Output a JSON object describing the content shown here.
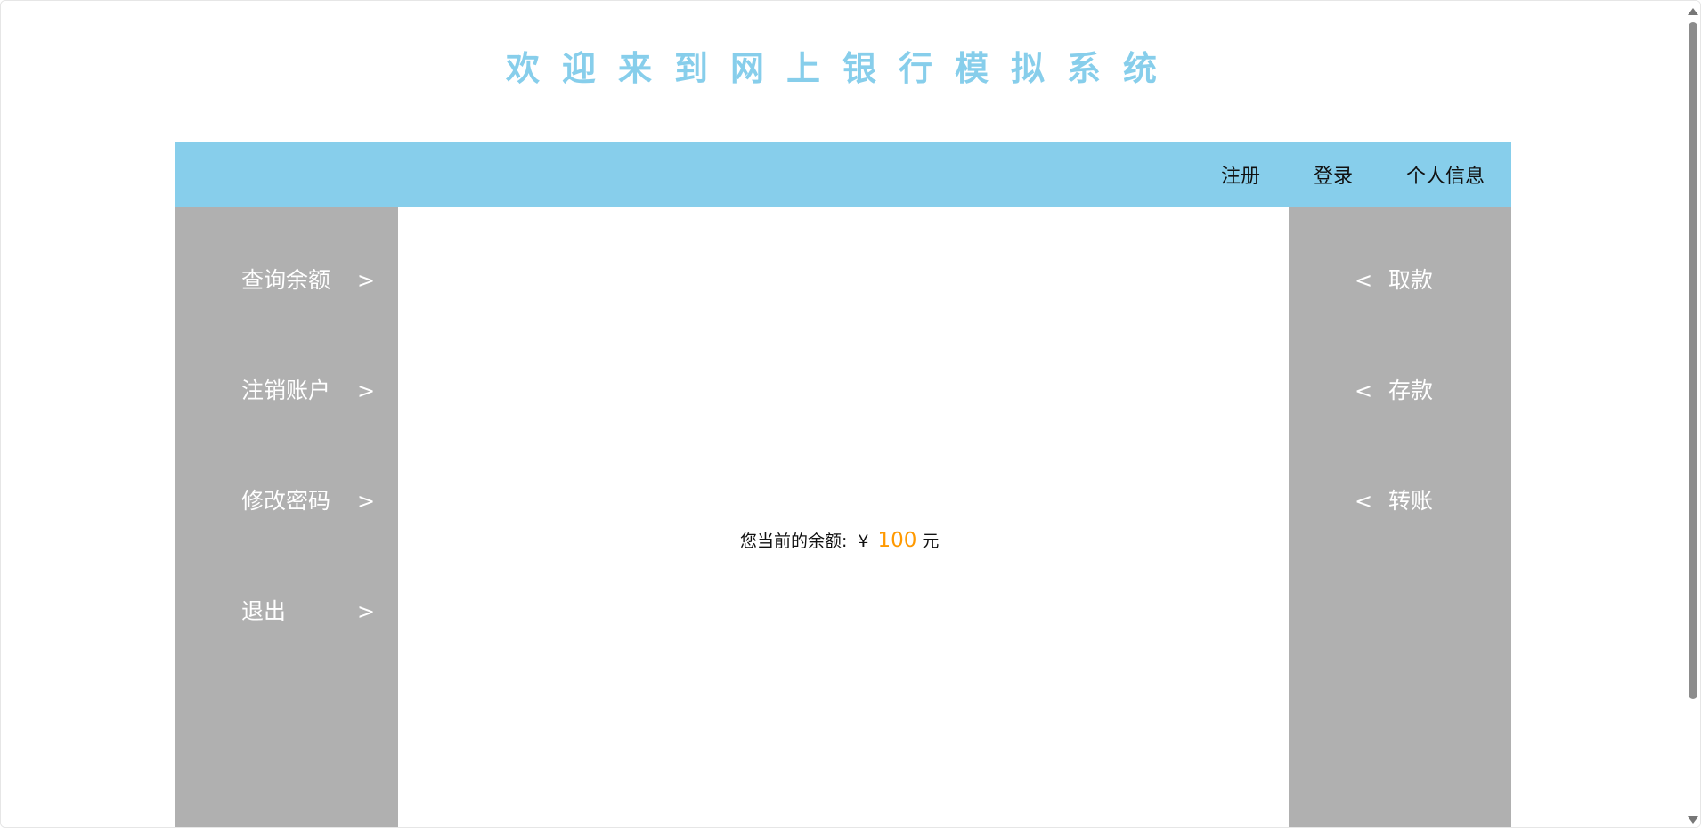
{
  "site": {
    "title": "欢迎来到网上银行模拟系统"
  },
  "topnav": {
    "items": [
      "注册",
      "登录",
      "个人信息"
    ]
  },
  "left_menu": {
    "items": [
      {
        "label": "查询余额",
        "arrow": ">"
      },
      {
        "label": "注销账户",
        "arrow": ">"
      },
      {
        "label": "修改密码",
        "arrow": ">"
      },
      {
        "label": "退出",
        "arrow": ">"
      }
    ]
  },
  "right_menu": {
    "items": [
      {
        "label": "取款",
        "arrow": "<"
      },
      {
        "label": "存款",
        "arrow": "<"
      },
      {
        "label": "转账",
        "arrow": "<"
      }
    ]
  },
  "balance": {
    "prefix": "您当前的余额:",
    "currency": "¥",
    "amount": "100",
    "unit": "元"
  },
  "colors": {
    "accent": "#87ceeb",
    "sidebar": "#b0b0b0",
    "amount": "#ff9900"
  }
}
